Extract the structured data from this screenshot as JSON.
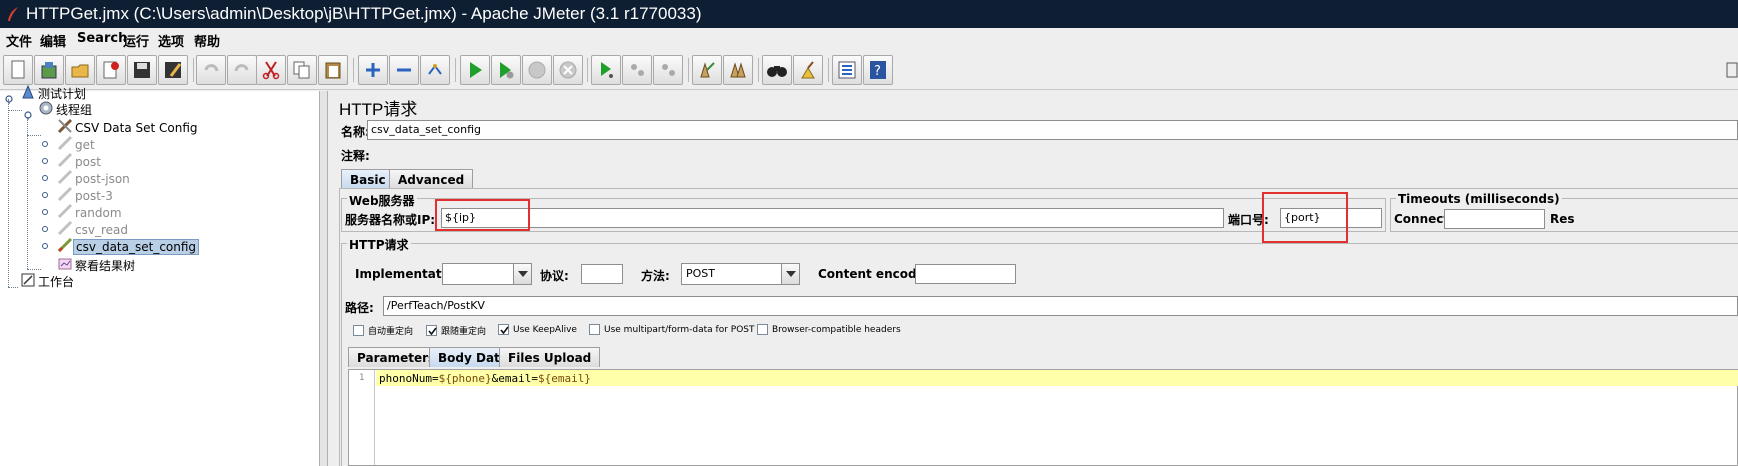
{
  "window": {
    "title": "HTTPGet.jmx (C:\\Users\\admin\\Desktop\\jB\\HTTPGet.jmx) - Apache JMeter (3.1 r1770033)",
    "titlebar_color": "#0e1f33"
  },
  "menu": [
    "文件",
    "编辑",
    "Search",
    "运行",
    "选项",
    "帮助"
  ],
  "toolbar": {
    "buttons": [
      "new-icon",
      "templates-icon",
      "open-icon",
      "close-icon",
      "save-icon",
      "save-as-icon",
      "undo-icon",
      "redo-icon",
      "cut-icon",
      "copy-icon",
      "paste-icon",
      "expand-icon",
      "collapse-icon",
      "toggle-icon",
      "start-icon",
      "start-no-pause-icon",
      "stop-icon",
      "shutdown-icon",
      "remote-start-icon",
      "remote-stop-icon",
      "remote-exit-icon",
      "clear-icon",
      "clear-all-icon",
      "search-icon",
      "reset-search-icon",
      "function-helper-icon",
      "help-icon"
    ]
  },
  "tree": {
    "nodes": [
      {
        "label": "测试计划",
        "icon": "test-plan-icon",
        "state": "normal"
      },
      {
        "label": "线程组",
        "icon": "thread-group-icon",
        "state": "normal"
      },
      {
        "label": "CSV Data Set Config",
        "icon": "csv-config-icon",
        "state": "normal"
      },
      {
        "label": "get",
        "icon": "sampler-icon",
        "state": "disabled"
      },
      {
        "label": "post",
        "icon": "sampler-icon",
        "state": "disabled"
      },
      {
        "label": "post-json",
        "icon": "sampler-icon",
        "state": "disabled"
      },
      {
        "label": "post-3",
        "icon": "sampler-icon",
        "state": "disabled"
      },
      {
        "label": "random",
        "icon": "sampler-icon",
        "state": "disabled"
      },
      {
        "label": "csv_read",
        "icon": "sampler-icon",
        "state": "disabled"
      },
      {
        "label": "csv_data_set_config",
        "icon": "sampler-icon",
        "state": "selected"
      },
      {
        "label": "察看结果树",
        "icon": "listener-icon",
        "state": "normal"
      },
      {
        "label": "工作台",
        "icon": "workbench-icon",
        "state": "normal"
      }
    ]
  },
  "panel": {
    "title": "HTTP请求",
    "name_label": "名称:",
    "name_value": "csv_data_set_config",
    "comment_label": "注释:",
    "comment_value": "",
    "tabs": [
      "Basic",
      "Advanced"
    ],
    "web_server": {
      "group_title": "Web服务器",
      "server_label": "服务器名称或IP:",
      "server_value": "${ip}",
      "port_label": "端口号:",
      "port_value": "{port}"
    },
    "timeouts": {
      "group_title": "Timeouts (milliseconds)",
      "connect_label": "Connect:",
      "connect_value": "",
      "response_label_partial": "Res"
    },
    "http_request": {
      "group_title": "HTTP请求",
      "implementation_label": "Implementation:",
      "implementation_value": "",
      "protocol_label": "协议:",
      "protocol_value": "",
      "method_label": "方法:",
      "method_value": "POST",
      "encoding_label": "Content encoding:",
      "encoding_value": "",
      "path_label": "路径:",
      "path_value": "/PerfTeach/PostKV"
    },
    "checkboxes": [
      {
        "label": "自动重定向",
        "checked": false
      },
      {
        "label": "跟随重定向",
        "checked": true
      },
      {
        "label": "Use KeepAlive",
        "checked": true
      },
      {
        "label": "Use multipart/form-data for POST",
        "checked": false
      },
      {
        "label": "Browser-compatible headers",
        "checked": false
      }
    ],
    "body_tabs": [
      "Parameters",
      "Body Data",
      "Files Upload"
    ],
    "body": {
      "line_number": "1",
      "code_parts": [
        "phonoNum=",
        "${phone}",
        "&email=",
        "${email}"
      ]
    },
    "annotation_color": "#e03030"
  }
}
